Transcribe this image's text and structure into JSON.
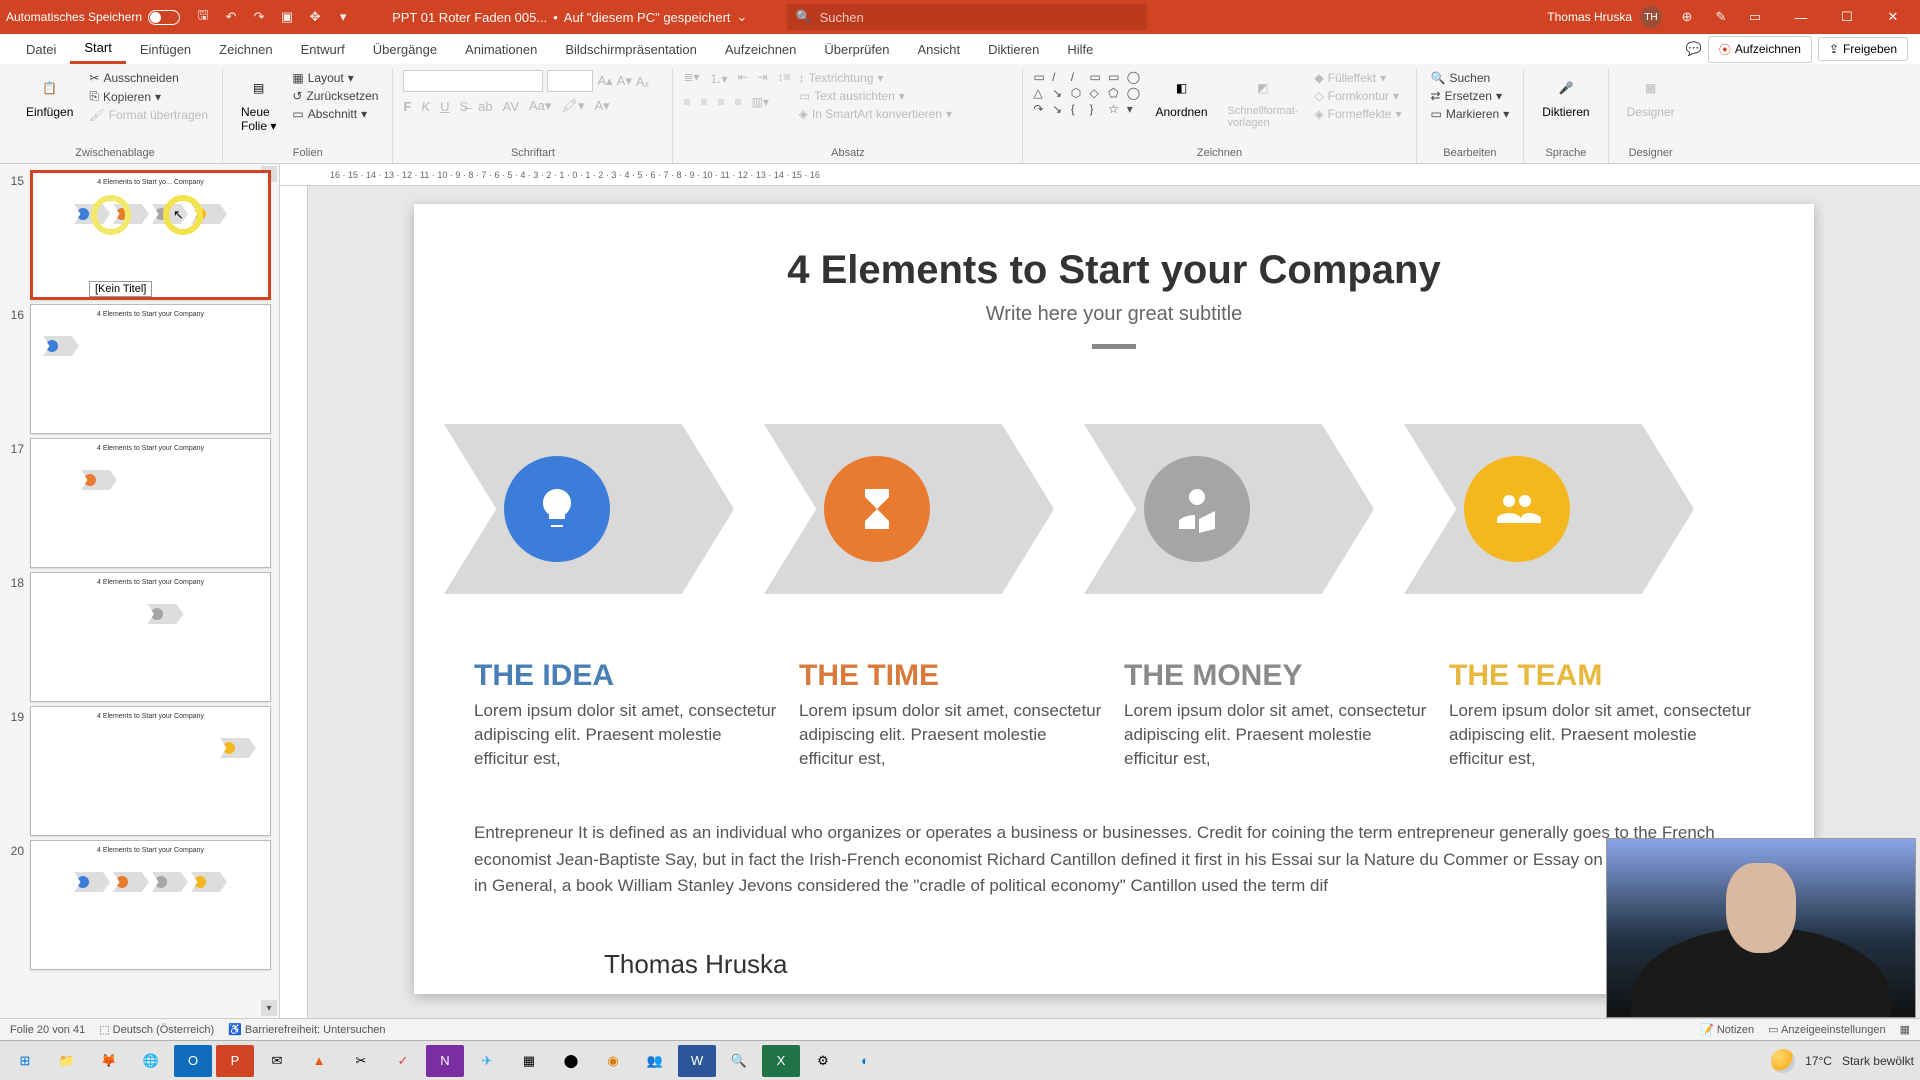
{
  "titlebar": {
    "autosave_label": "Automatisches Speichern",
    "doc_name": "PPT 01 Roter Faden 005...",
    "saved_status": "Auf \"diesem PC\" gespeichert",
    "search_placeholder": "Suchen",
    "user_name": "Thomas Hruska",
    "user_initials": "TH"
  },
  "tabs": {
    "items": [
      "Datei",
      "Start",
      "Einfügen",
      "Zeichnen",
      "Entwurf",
      "Übergänge",
      "Animationen",
      "Bildschirmpräsentation",
      "Aufzeichnen",
      "Überprüfen",
      "Ansicht",
      "Diktieren",
      "Hilfe"
    ],
    "active_index": 1,
    "record_btn": "Aufzeichnen",
    "share_btn": "Freigeben"
  },
  "ribbon": {
    "group_labels": [
      "Zwischenablage",
      "Folien",
      "Schriftart",
      "Absatz",
      "Zeichnen",
      "Bearbeiten",
      "Sprache",
      "Designer"
    ],
    "paste": "Einfügen",
    "cut": "Ausschneiden",
    "copy": "Kopieren",
    "format_painter": "Format übertragen",
    "new_slide_l1": "Neue",
    "new_slide_l2": "Folie",
    "layout": "Layout",
    "reset": "Zurücksetzen",
    "section": "Abschnitt",
    "text_direction": "Textrichtung",
    "align_text": "Text ausrichten",
    "smartart": "In SmartArt konvertieren",
    "arrange": "Anordnen",
    "quick_styles_l1": "Schnellformat-",
    "quick_styles_l2": "vorlagen",
    "fill_effect": "Fülleffekt",
    "shape_outline": "Formkontur",
    "shape_effects": "Formeffekte",
    "find": "Suchen",
    "replace": "Ersetzen",
    "select": "Markieren",
    "dictate": "Diktieren",
    "designer": "Designer"
  },
  "thumbnails": {
    "tooltip": "[Kein Titel]",
    "items": [
      {
        "num": "15",
        "title": "4 Elements to Start yo... Company",
        "selected": true
      },
      {
        "num": "16",
        "title": "4 Elements to Start your Company"
      },
      {
        "num": "17",
        "title": "4 Elements to Start your Company"
      },
      {
        "num": "18",
        "title": "4 Elements to Start your Company"
      },
      {
        "num": "19",
        "title": "4 Elements to Start your Company"
      },
      {
        "num": "20",
        "title": "4 Elements to Start your Company"
      }
    ]
  },
  "slide": {
    "title": "4 Elements to Start your Company",
    "subtitle": "Write here your great subtitle",
    "columns": [
      {
        "title": "THE IDEA",
        "color": "t-blue",
        "body": "Lorem ipsum dolor sit amet, consectetur adipiscing elit. Praesent molestie efficitur est,"
      },
      {
        "title": "THE TIME",
        "color": "t-orange",
        "body": "Lorem ipsum dolor sit amet, consectetur adipiscing elit. Praesent molestie efficitur est,"
      },
      {
        "title": "THE MONEY",
        "color": "t-gray",
        "body": "Lorem ipsum dolor sit amet, consectetur adipiscing elit. Praesent molestie efficitur est,"
      },
      {
        "title": "THE TEAM",
        "color": "t-yellow",
        "body": "Lorem ipsum dolor sit amet, consectetur adipiscing elit. Praesent molestie efficitur est,"
      }
    ],
    "entrepreneur_text": "Entrepreneur  It is defined as an individual who organizes or operates a business or businesses. Credit for coining the term entrepreneur generally goes to the French economist Jean-Baptiste Say, but in fact the Irish-French economist Richard Cantillon defined it first in his Essai sur la Nature du Commer or Essay on theNature of Trade in General, a book William Stanley Jevons considered the \"cradle of political economy\" Cantillon used the term dif",
    "author": "Thomas Hruska"
  },
  "statusbar": {
    "slide_count": "Folie 20 von 41",
    "language": "Deutsch (Österreich)",
    "accessibility": "Barrierefreiheit: Untersuchen",
    "notes": "Notizen",
    "display_settings": "Anzeigeeinstellungen"
  },
  "taskbar": {
    "weather_temp": "17°C",
    "weather_desc": "Stark bewölkt"
  }
}
